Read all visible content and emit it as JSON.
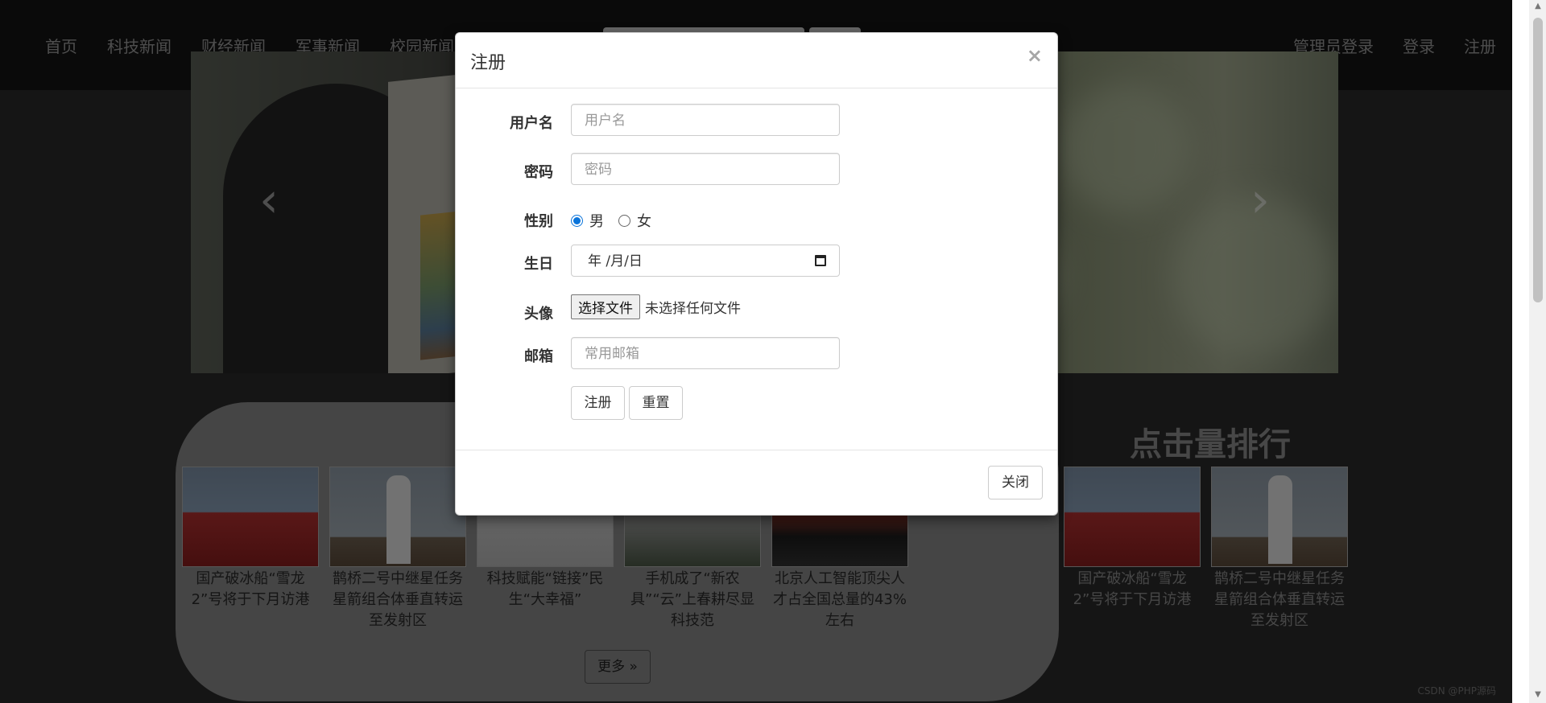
{
  "nav": {
    "left": [
      "首页",
      "科技新闻",
      "财经新闻",
      "军事新闻",
      "校园新闻"
    ],
    "right": [
      "管理员登录",
      "登录",
      "注册"
    ]
  },
  "carousel": {
    "prev": "‹",
    "next": "›"
  },
  "news": {
    "rank_title": "点击量排行",
    "items": [
      "国产破冰船“雪龙2”号将于下月访港",
      "鹊桥二号中继星任务星箭组合体垂直转运至发射区",
      "科技赋能“链接”民生“大幸福”",
      "手机成了“新农具”“云”上春耕尽显科技范",
      "北京人工智能顶尖人才占全国总量的43%左右"
    ],
    "rank_items": [
      "国产破冰船“雪龙2”号将于下月访港",
      "鹊桥二号中继星任务星箭组合体垂直转运至发射区"
    ],
    "more": "更多 »"
  },
  "modal": {
    "title": "注册",
    "close_x": "×",
    "username_label": "用户名",
    "username_placeholder": "用户名",
    "password_label": "密码",
    "password_placeholder": "密码",
    "gender_label": "性别",
    "gender_male": "男",
    "gender_female": "女",
    "gender_selected": "男",
    "birthday_label": "生日",
    "birthday_value": "年 /月/日",
    "avatar_label": "头像",
    "file_button": "选择文件",
    "file_status": "未选择任何文件",
    "email_label": "邮箱",
    "email_placeholder": "常用邮箱",
    "submit": "注册",
    "reset": "重置",
    "close_button": "关闭"
  },
  "watermark": "CSDN @PHP源码"
}
